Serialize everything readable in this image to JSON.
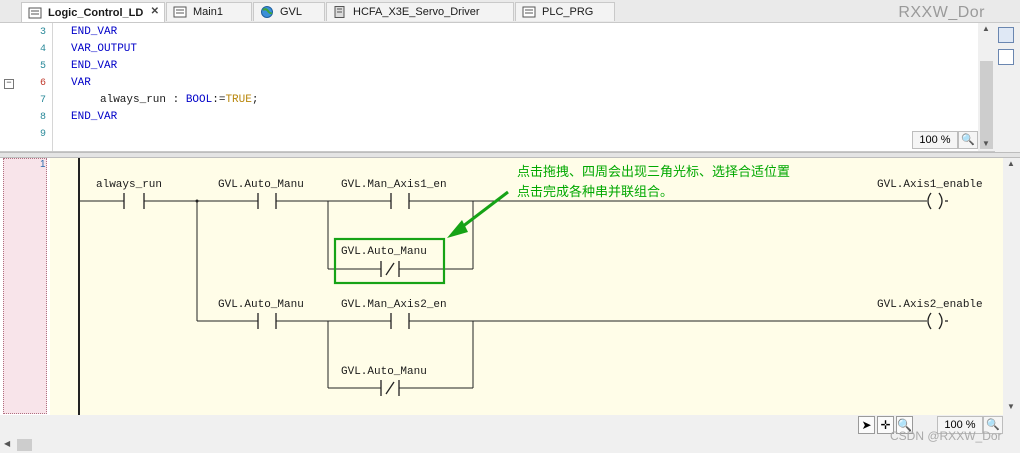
{
  "tabs": [
    {
      "label": "Logic_Control_LD",
      "active": true,
      "icon": "ld-pou-icon",
      "closable": true
    },
    {
      "label": "Main1",
      "icon": "pou-icon"
    },
    {
      "label": "GVL",
      "icon": "globe-icon"
    },
    {
      "label": "HCFA_X3E_Servo_Driver",
      "icon": "device-icon"
    },
    {
      "label": "PLC_PRG",
      "icon": "pou-icon"
    }
  ],
  "brand": "RXXW_Dor",
  "declaration": {
    "lines": [
      {
        "num": "3",
        "text": "END_VAR"
      },
      {
        "num": "4",
        "text": "VAR_OUTPUT"
      },
      {
        "num": "5",
        "text": "END_VAR"
      },
      {
        "num": "6",
        "text": "VAR"
      },
      {
        "num": "7",
        "text": "always_run : BOOL:=TRUE;",
        "var": "always_run",
        "type": "BOOL",
        "init": "TRUE"
      },
      {
        "num": "8",
        "text": "END_VAR"
      },
      {
        "num": "9",
        "text": ""
      }
    ],
    "zoom": "100 %"
  },
  "network": {
    "number": "1",
    "contacts": {
      "always_run": "always_run",
      "auto1": "GVL.Auto_Manu",
      "man1": "GVL.Man_Axis1_en",
      "auto1_nc": "GVL.Auto_Manu",
      "auto2": "GVL.Auto_Manu",
      "man2": "GVL.Man_Axis2_en",
      "auto2_nc": "GVL.Auto_Manu"
    },
    "coils": {
      "axis1": "GVL.Axis1_enable",
      "axis2": "GVL.Axis2_enable"
    }
  },
  "annotation": {
    "line1": "点击拖拽、四周会出现三角光标、选择合适位置",
    "line2": "点击完成各种串并联组合。",
    "color": "#00a800"
  },
  "bottom": {
    "zoom": "100 %",
    "watermark": "CSDN @RXXW_Dor"
  }
}
